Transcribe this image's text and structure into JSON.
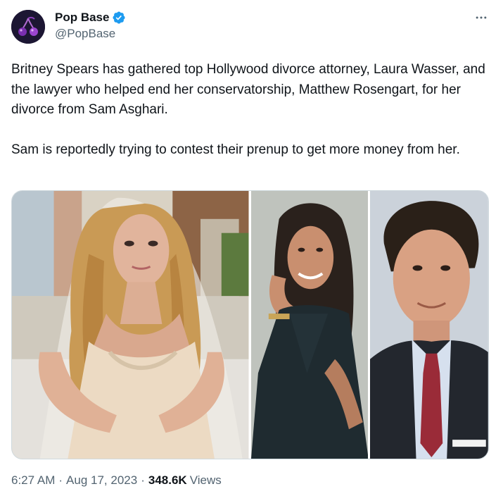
{
  "author": {
    "display_name": "Pop Base",
    "handle": "@PopBase",
    "verified": true,
    "avatar_icon": "cherry-icon",
    "verified_icon": "verified-badge-icon"
  },
  "menu_icon": "more-horizontal-icon",
  "tweet": {
    "paragraphs": [
      "Britney Spears has gathered top Hollywood divorce attorney, Laura Wasser, and the lawyer who helped end her conservatorship, Matthew Rosengart, for her divorce from Sam Asghari.",
      "Sam is reportedly trying to contest their prenup to get more money from her."
    ]
  },
  "footer": {
    "time": "6:27 AM",
    "separator": "·",
    "date": "Aug 17, 2023",
    "views_count": "348.6K",
    "views_label": "Views"
  },
  "colors": {
    "text_primary": "#0f1419",
    "text_secondary": "#536471",
    "verified_blue": "#1d9bf0",
    "border": "#cfd9de"
  }
}
